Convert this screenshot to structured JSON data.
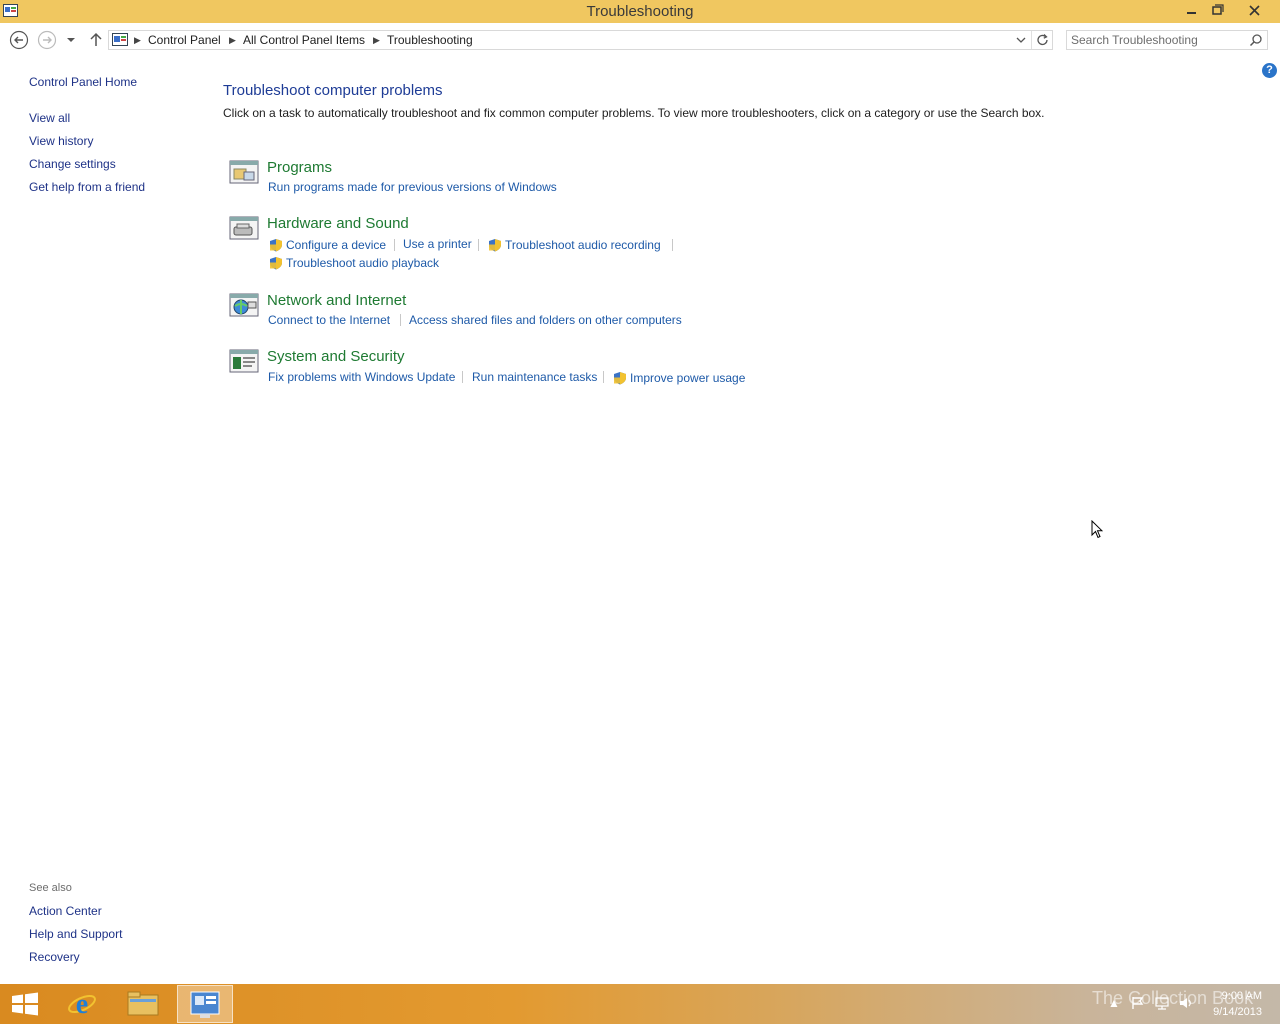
{
  "window": {
    "title": "Troubleshooting"
  },
  "address": {
    "crumbs": [
      "Control Panel",
      "All Control Panel Items",
      "Troubleshooting"
    ]
  },
  "search": {
    "placeholder": "Search Troubleshooting"
  },
  "sidebar": {
    "home": "Control Panel Home",
    "links": [
      "View all",
      "View history",
      "Change settings",
      "Get help from a friend"
    ],
    "see_also_label": "See also",
    "see_also": [
      "Action Center",
      "Help and Support",
      "Recovery"
    ]
  },
  "main": {
    "title": "Troubleshoot computer problems",
    "description": "Click on a task to automatically troubleshoot and fix common computer problems. To view more troubleshooters, click on a category or use the Search box.",
    "categories": [
      {
        "title": "Programs",
        "tasks": [
          "Run programs made for previous versions of Windows"
        ]
      },
      {
        "title": "Hardware and Sound",
        "tasks": [
          "Configure a device",
          "Use a printer",
          "Troubleshoot audio recording",
          "Troubleshoot audio playback"
        ]
      },
      {
        "title": "Network and Internet",
        "tasks": [
          "Connect to the Internet",
          "Access shared files and folders on other computers"
        ]
      },
      {
        "title": "System and Security",
        "tasks": [
          "Fix problems with Windows Update",
          "Run maintenance tasks",
          "Improve power usage"
        ]
      }
    ]
  },
  "taskbar": {
    "time": "9:00 AM",
    "date": "9/14/2013",
    "watermark": "The Collection Book"
  },
  "colors": {
    "titlebar": "#f0c760",
    "link": "#1e5aa8",
    "category": "#1e7a32"
  }
}
